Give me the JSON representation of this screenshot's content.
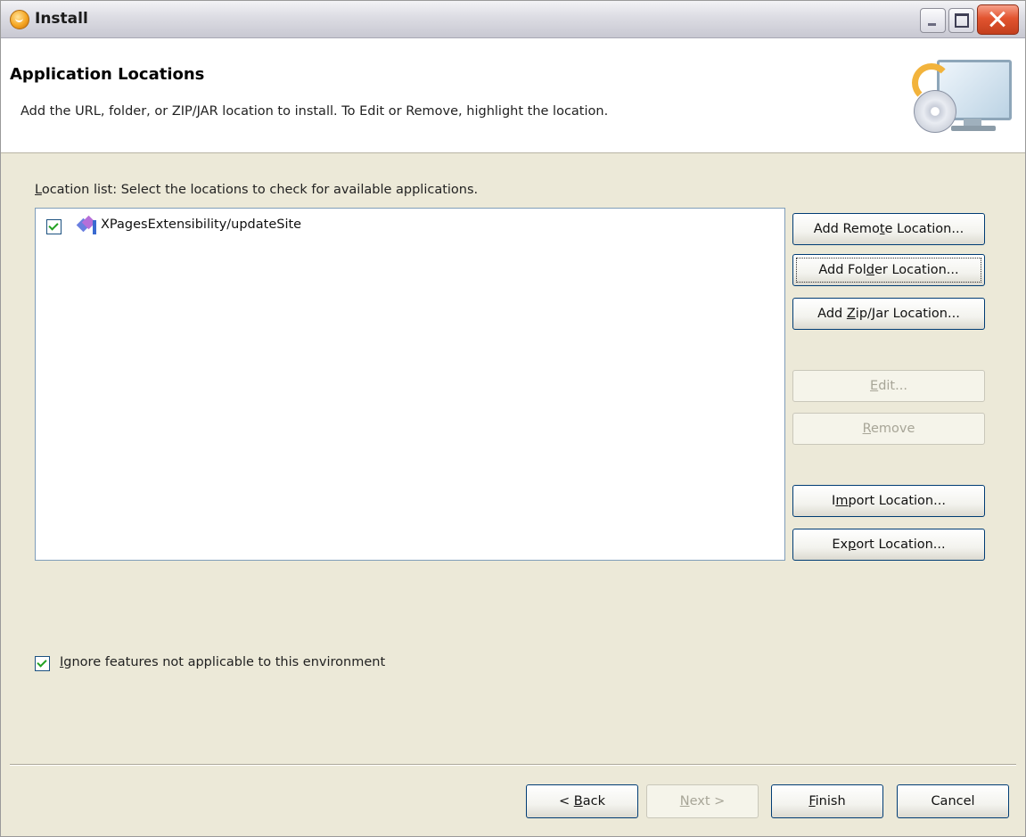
{
  "window": {
    "title": "Install"
  },
  "header": {
    "title": "Application Locations",
    "description": "Add the URL, folder, or ZIP/JAR location to install. To Edit or Remove, highlight the location."
  },
  "location_list": {
    "label_prefix": "",
    "label_mnemonic": "L",
    "label_rest": "ocation list: Select the locations to check for available applications.",
    "items": [
      {
        "label": "XPagesExtensibility/updateSite",
        "checked": true
      }
    ]
  },
  "buttons": {
    "add_remote": {
      "pre": "Add Remo",
      "mn": "t",
      "post": "e Location..."
    },
    "add_folder": {
      "pre": "Add Fol",
      "mn": "d",
      "post": "er Location..."
    },
    "add_zip": {
      "pre": "Add ",
      "mn": "Z",
      "post": "ip/Jar Location..."
    },
    "edit": {
      "pre": "",
      "mn": "E",
      "post": "dit..."
    },
    "remove": {
      "pre": "",
      "mn": "R",
      "post": "emove"
    },
    "import": {
      "pre": "I",
      "mn": "m",
      "post": "port Location..."
    },
    "export": {
      "pre": "Ex",
      "mn": "p",
      "post": "ort Location..."
    }
  },
  "ignore": {
    "checked": true,
    "mnemonic": "I",
    "rest": "gnore features not applicable to this environment"
  },
  "nav": {
    "back": {
      "pre": "< ",
      "mn": "B",
      "post": "ack"
    },
    "next": {
      "pre": "",
      "mn": "N",
      "post": "ext >"
    },
    "finish": {
      "pre": "",
      "mn": "F",
      "post": "inish"
    },
    "cancel": {
      "pre": "Cancel",
      "mn": "",
      "post": ""
    }
  }
}
